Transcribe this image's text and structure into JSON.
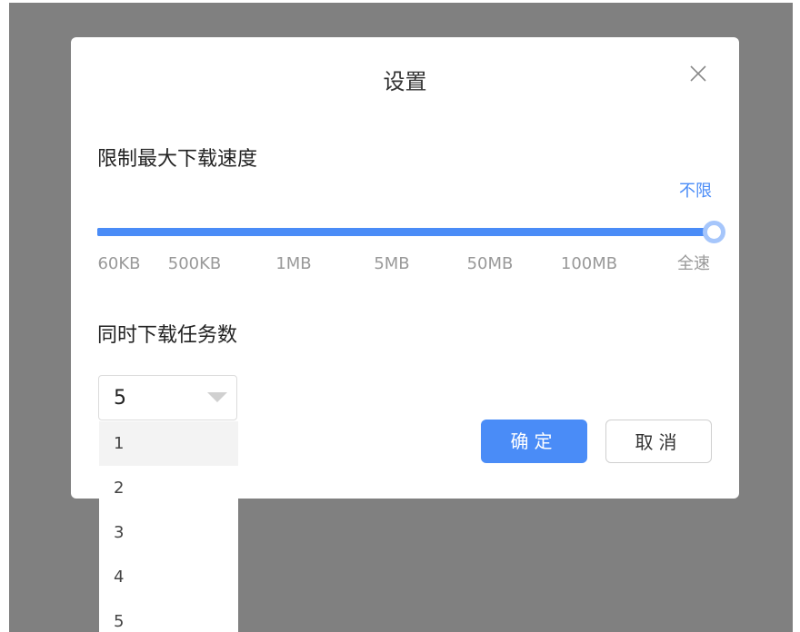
{
  "dialog": {
    "title": "设置",
    "close_icon": "close-icon"
  },
  "speed": {
    "label": "限制最大下载速度",
    "current_value": "不限",
    "position": 1.0,
    "ticks": [
      "60KB",
      "500KB",
      "1MB",
      "5MB",
      "50MB",
      "100MB",
      "全速"
    ]
  },
  "tasks": {
    "label": "同时下载任务数",
    "selected": "5",
    "options": [
      "1",
      "2",
      "3",
      "4",
      "5"
    ],
    "highlighted": "1"
  },
  "buttons": {
    "ok_label": "确定",
    "cancel_label": "取消"
  },
  "colors": {
    "accent": "#4a8cf7",
    "backdrop": "#808080"
  }
}
